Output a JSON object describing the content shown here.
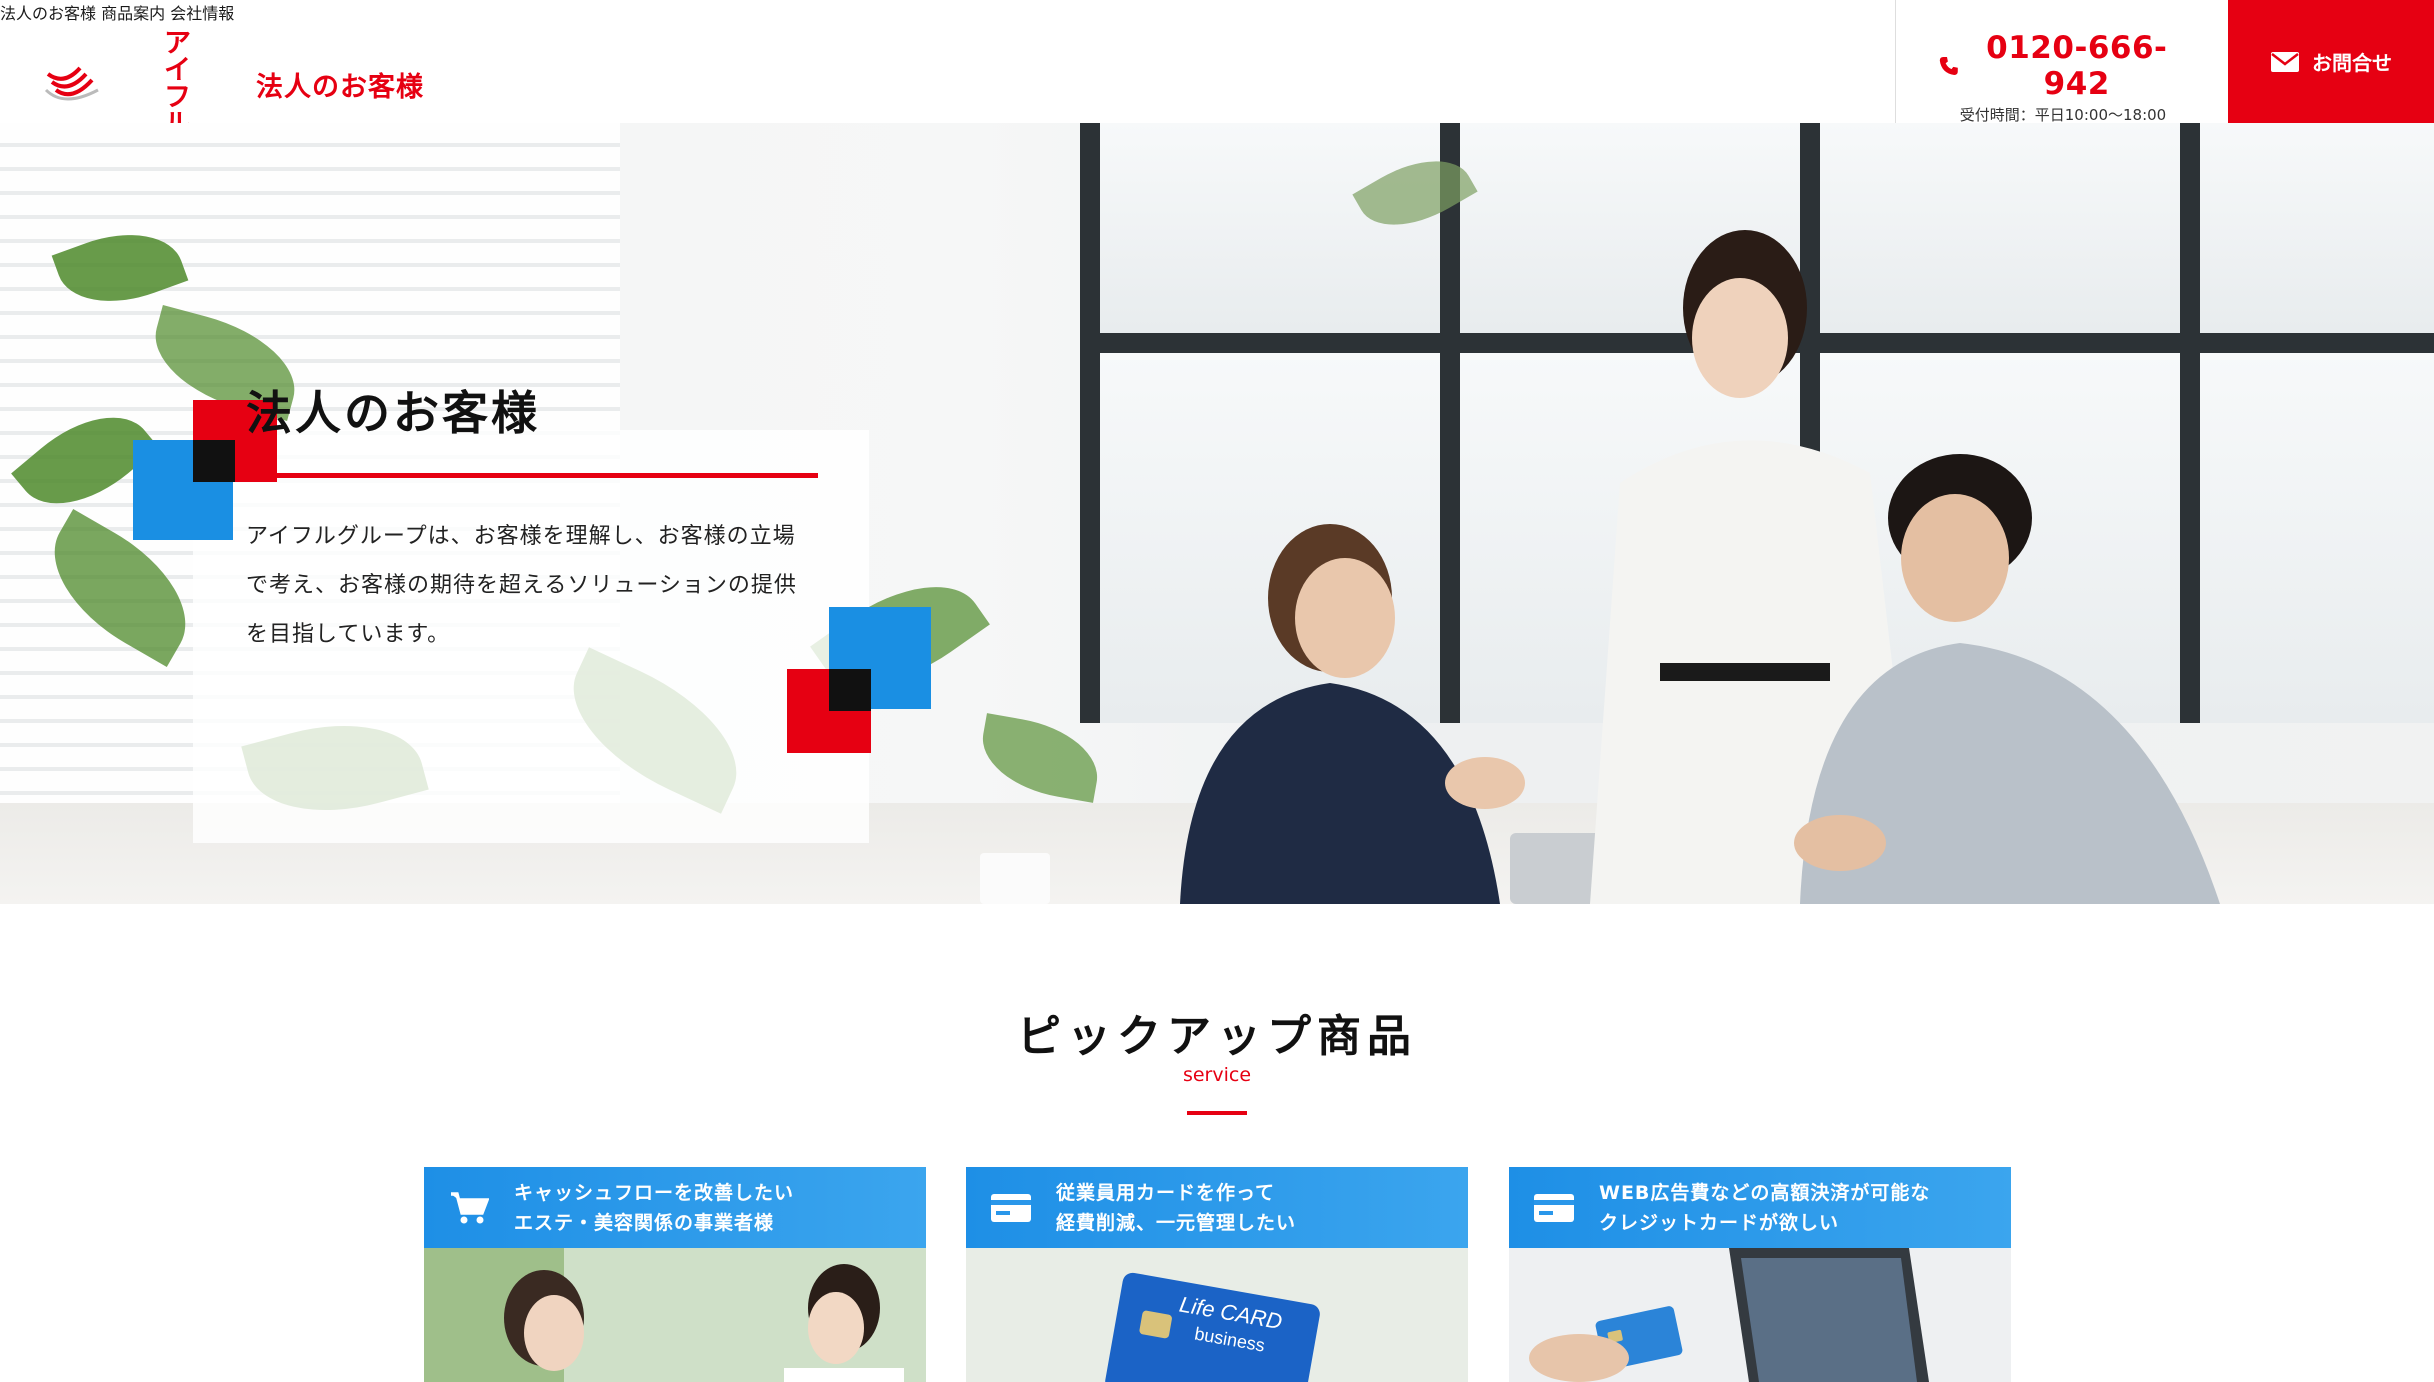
{
  "header": {
    "logo_kana": "アイフル",
    "title": "法人のお客様",
    "nav": [
      "法人のお客様",
      "商品案内",
      "会社情報"
    ],
    "phone": "0120-666-942",
    "hours": "受付時間：平日10:00〜18:00",
    "contact_label": "お問合せ"
  },
  "hero": {
    "title": "法人のお客様",
    "text": "アイフルグループは、お客様を理解し、お客様の立場で考え、お客様の期待を超えるソリューションの提供を目指しています。"
  },
  "pickup": {
    "title": "ピックアップ商品",
    "subtitle": "service",
    "cards": [
      {
        "icon": "cart-icon",
        "line1": "キャッシュフローを改善したい",
        "line2": "エステ・美容関係の事業者様"
      },
      {
        "icon": "card-icon",
        "line1": "従業員用カードを作って",
        "line2": "経費削減、一元管理したい"
      },
      {
        "icon": "card-icon",
        "line1": "WEB広告費などの高額決済が可能な",
        "line2": "クレジットカードが欲しい"
      }
    ]
  },
  "colors": {
    "brand_red": "#e60012",
    "accent_blue": "#1e8fe6"
  }
}
